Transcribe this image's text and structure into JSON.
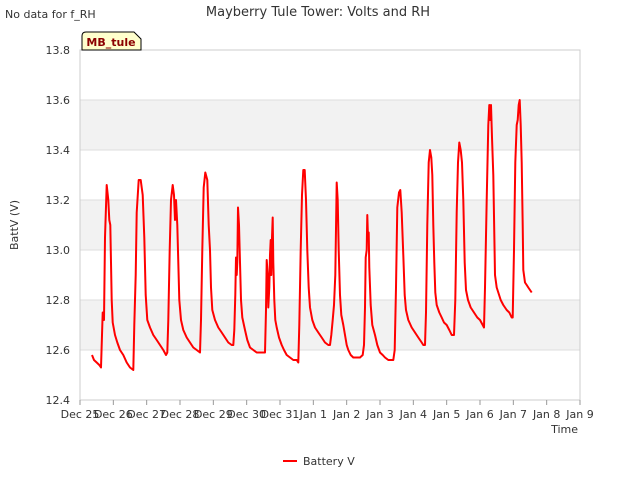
{
  "no_data_note": "No data for f_RH",
  "station_badge": "MB_tule",
  "chart_data": {
    "type": "line",
    "title": "Mayberry Tule Tower: Volts and RH",
    "xlabel": "Time",
    "ylabel": "BattV (V)",
    "ylim": [
      12.4,
      13.8
    ],
    "xlim": [
      0,
      15
    ],
    "yticks": [
      12.4,
      12.6,
      12.8,
      13.0,
      13.2,
      13.4,
      13.6,
      13.8
    ],
    "ytick_labels": [
      "12.4",
      "12.6",
      "12.8",
      "13.0",
      "13.2",
      "13.4",
      "13.6",
      "13.8"
    ],
    "xticks": [
      0,
      1,
      2,
      3,
      4,
      5,
      6,
      7,
      8,
      9,
      10,
      11,
      12,
      13,
      14,
      15
    ],
    "xtick_labels": [
      "Dec 25",
      "Dec 26",
      "Dec 27",
      "Dec 28",
      "Dec 29",
      "Dec 30",
      "Dec 31",
      "Jan 1",
      "Jan 2",
      "Jan 3",
      "Jan 4",
      "Jan 5",
      "Jan 6",
      "Jan 7",
      "Jan 8",
      "Jan 9"
    ],
    "grid": true,
    "legend": "bottom-center",
    "colors": {
      "series": "#ff0000",
      "band": "#f2f2f2",
      "grid": "#dddddd",
      "badge_bg": "#ffffcc",
      "badge_text": "#8b0000"
    },
    "series": [
      {
        "name": "Battery V",
        "points": [
          [
            0.36,
            12.58
          ],
          [
            0.42,
            12.56
          ],
          [
            0.5,
            12.55
          ],
          [
            0.58,
            12.54
          ],
          [
            0.63,
            12.53
          ],
          [
            0.68,
            12.75
          ],
          [
            0.72,
            12.72
          ],
          [
            0.75,
            13.05
          ],
          [
            0.8,
            13.26
          ],
          [
            0.85,
            13.2
          ],
          [
            0.88,
            13.12
          ],
          [
            0.91,
            13.1
          ],
          [
            0.93,
            12.95
          ],
          [
            0.95,
            12.8
          ],
          [
            0.98,
            12.71
          ],
          [
            1.05,
            12.66
          ],
          [
            1.12,
            12.63
          ],
          [
            1.2,
            12.6
          ],
          [
            1.3,
            12.58
          ],
          [
            1.4,
            12.55
          ],
          [
            1.5,
            12.53
          ],
          [
            1.6,
            12.52
          ],
          [
            1.63,
            12.7
          ],
          [
            1.67,
            12.9
          ],
          [
            1.7,
            13.15
          ],
          [
            1.76,
            13.28
          ],
          [
            1.82,
            13.28
          ],
          [
            1.88,
            13.22
          ],
          [
            1.93,
            13.05
          ],
          [
            1.97,
            12.82
          ],
          [
            2.02,
            12.72
          ],
          [
            2.1,
            12.69
          ],
          [
            2.2,
            12.66
          ],
          [
            2.3,
            12.64
          ],
          [
            2.4,
            12.62
          ],
          [
            2.5,
            12.6
          ],
          [
            2.58,
            12.58
          ],
          [
            2.62,
            12.59
          ],
          [
            2.65,
            12.72
          ],
          [
            2.69,
            13.0
          ],
          [
            2.73,
            13.2
          ],
          [
            2.78,
            13.26
          ],
          [
            2.82,
            13.22
          ],
          [
            2.85,
            13.12
          ],
          [
            2.88,
            13.2
          ],
          [
            2.92,
            13.1
          ],
          [
            2.95,
            12.95
          ],
          [
            2.98,
            12.8
          ],
          [
            3.03,
            12.72
          ],
          [
            3.1,
            12.68
          ],
          [
            3.2,
            12.65
          ],
          [
            3.3,
            12.63
          ],
          [
            3.4,
            12.61
          ],
          [
            3.5,
            12.6
          ],
          [
            3.6,
            12.59
          ],
          [
            3.63,
            12.72
          ],
          [
            3.67,
            13.0
          ],
          [
            3.71,
            13.25
          ],
          [
            3.76,
            13.31
          ],
          [
            3.82,
            13.28
          ],
          [
            3.86,
            13.1
          ],
          [
            3.9,
            13.0
          ],
          [
            3.93,
            12.85
          ],
          [
            3.97,
            12.76
          ],
          [
            4.05,
            12.72
          ],
          [
            4.15,
            12.69
          ],
          [
            4.25,
            12.67
          ],
          [
            4.35,
            12.65
          ],
          [
            4.45,
            12.63
          ],
          [
            4.55,
            12.62
          ],
          [
            4.6,
            12.62
          ],
          [
            4.63,
            12.68
          ],
          [
            4.66,
            12.82
          ],
          [
            4.68,
            12.97
          ],
          [
            4.7,
            12.9
          ],
          [
            4.72,
            12.95
          ],
          [
            4.74,
            13.17
          ],
          [
            4.77,
            13.1
          ],
          [
            4.8,
            12.95
          ],
          [
            4.83,
            12.8
          ],
          [
            4.87,
            12.73
          ],
          [
            4.95,
            12.68
          ],
          [
            5.02,
            12.64
          ],
          [
            5.1,
            12.61
          ],
          [
            5.2,
            12.6
          ],
          [
            5.3,
            12.59
          ],
          [
            5.45,
            12.59
          ],
          [
            5.55,
            12.59
          ],
          [
            5.58,
            12.76
          ],
          [
            5.6,
            12.96
          ],
          [
            5.63,
            12.9
          ],
          [
            5.65,
            12.77
          ],
          [
            5.68,
            12.85
          ],
          [
            5.7,
            12.98
          ],
          [
            5.72,
            13.04
          ],
          [
            5.74,
            12.9
          ],
          [
            5.76,
            13.05
          ],
          [
            5.78,
            13.13
          ],
          [
            5.8,
            12.95
          ],
          [
            5.83,
            12.8
          ],
          [
            5.86,
            12.72
          ],
          [
            5.9,
            12.69
          ],
          [
            5.97,
            12.65
          ],
          [
            6.05,
            12.62
          ],
          [
            6.12,
            12.6
          ],
          [
            6.2,
            12.58
          ],
          [
            6.3,
            12.57
          ],
          [
            6.4,
            12.56
          ],
          [
            6.5,
            12.56
          ],
          [
            6.55,
            12.55
          ],
          [
            6.58,
            12.7
          ],
          [
            6.62,
            13.0
          ],
          [
            6.66,
            13.22
          ],
          [
            6.7,
            13.32
          ],
          [
            6.74,
            13.32
          ],
          [
            6.78,
            13.2
          ],
          [
            6.82,
            13.0
          ],
          [
            6.86,
            12.85
          ],
          [
            6.9,
            12.77
          ],
          [
            6.97,
            12.72
          ],
          [
            7.05,
            12.69
          ],
          [
            7.15,
            12.67
          ],
          [
            7.25,
            12.65
          ],
          [
            7.35,
            12.63
          ],
          [
            7.45,
            12.62
          ],
          [
            7.5,
            12.62
          ],
          [
            7.54,
            12.66
          ],
          [
            7.58,
            12.72
          ],
          [
            7.62,
            12.78
          ],
          [
            7.66,
            12.9
          ],
          [
            7.7,
            13.27
          ],
          [
            7.73,
            13.2
          ],
          [
            7.76,
            13.0
          ],
          [
            7.8,
            12.82
          ],
          [
            7.84,
            12.74
          ],
          [
            7.9,
            12.7
          ],
          [
            7.95,
            12.66
          ],
          [
            8.0,
            12.62
          ],
          [
            8.05,
            12.6
          ],
          [
            8.12,
            12.58
          ],
          [
            8.2,
            12.57
          ],
          [
            8.3,
            12.57
          ],
          [
            8.4,
            12.57
          ],
          [
            8.48,
            12.58
          ],
          [
            8.52,
            12.62
          ],
          [
            8.55,
            12.77
          ],
          [
            8.57,
            12.97
          ],
          [
            8.6,
            13.0
          ],
          [
            8.62,
            13.14
          ],
          [
            8.64,
            13.05
          ],
          [
            8.66,
            13.07
          ],
          [
            8.68,
            12.93
          ],
          [
            8.72,
            12.78
          ],
          [
            8.77,
            12.7
          ],
          [
            8.85,
            12.66
          ],
          [
            8.92,
            12.62
          ],
          [
            9.0,
            12.59
          ],
          [
            9.08,
            12.58
          ],
          [
            9.15,
            12.57
          ],
          [
            9.25,
            12.56
          ],
          [
            9.35,
            12.56
          ],
          [
            9.4,
            12.56
          ],
          [
            9.44,
            12.6
          ],
          [
            9.48,
            12.85
          ],
          [
            9.52,
            13.17
          ],
          [
            9.57,
            13.23
          ],
          [
            9.61,
            13.24
          ],
          [
            9.65,
            13.15
          ],
          [
            9.7,
            12.98
          ],
          [
            9.74,
            12.82
          ],
          [
            9.78,
            12.76
          ],
          [
            9.85,
            12.72
          ],
          [
            9.95,
            12.69
          ],
          [
            10.05,
            12.67
          ],
          [
            10.15,
            12.65
          ],
          [
            10.25,
            12.63
          ],
          [
            10.3,
            12.62
          ],
          [
            10.35,
            12.62
          ],
          [
            10.38,
            12.75
          ],
          [
            10.42,
            13.1
          ],
          [
            10.46,
            13.35
          ],
          [
            10.5,
            13.4
          ],
          [
            10.54,
            13.37
          ],
          [
            10.57,
            13.3
          ],
          [
            10.6,
            13.1
          ],
          [
            10.63,
            12.95
          ],
          [
            10.66,
            12.83
          ],
          [
            10.7,
            12.78
          ],
          [
            10.78,
            12.75
          ],
          [
            10.85,
            12.73
          ],
          [
            10.92,
            12.71
          ],
          [
            11.0,
            12.7
          ],
          [
            11.08,
            12.68
          ],
          [
            11.15,
            12.66
          ],
          [
            11.22,
            12.66
          ],
          [
            11.26,
            12.8
          ],
          [
            11.3,
            13.15
          ],
          [
            11.34,
            13.35
          ],
          [
            11.38,
            13.43
          ],
          [
            11.42,
            13.4
          ],
          [
            11.46,
            13.35
          ],
          [
            11.5,
            13.2
          ],
          [
            11.54,
            12.95
          ],
          [
            11.58,
            12.84
          ],
          [
            11.64,
            12.8
          ],
          [
            11.72,
            12.77
          ],
          [
            11.82,
            12.75
          ],
          [
            11.92,
            12.73
          ],
          [
            12.0,
            12.72
          ],
          [
            12.08,
            12.7
          ],
          [
            12.12,
            12.69
          ],
          [
            12.15,
            12.85
          ],
          [
            12.2,
            13.2
          ],
          [
            12.25,
            13.5
          ],
          [
            12.28,
            13.58
          ],
          [
            12.31,
            13.52
          ],
          [
            12.33,
            13.58
          ],
          [
            12.36,
            13.45
          ],
          [
            12.4,
            13.3
          ],
          [
            12.45,
            12.9
          ],
          [
            12.5,
            12.85
          ],
          [
            12.55,
            12.83
          ],
          [
            12.62,
            12.8
          ],
          [
            12.7,
            12.78
          ],
          [
            12.8,
            12.76
          ],
          [
            12.88,
            12.75
          ],
          [
            12.95,
            12.73
          ],
          [
            12.98,
            12.73
          ],
          [
            13.02,
            13.0
          ],
          [
            13.06,
            13.35
          ],
          [
            13.1,
            13.5
          ],
          [
            13.13,
            13.52
          ],
          [
            13.16,
            13.58
          ],
          [
            13.19,
            13.6
          ],
          [
            13.22,
            13.5
          ],
          [
            13.25,
            13.35
          ],
          [
            13.28,
            13.1
          ],
          [
            13.3,
            12.92
          ],
          [
            13.35,
            12.87
          ],
          [
            13.4,
            12.86
          ],
          [
            13.45,
            12.85
          ],
          [
            13.5,
            12.84
          ],
          [
            13.55,
            12.83
          ]
        ]
      }
    ]
  }
}
